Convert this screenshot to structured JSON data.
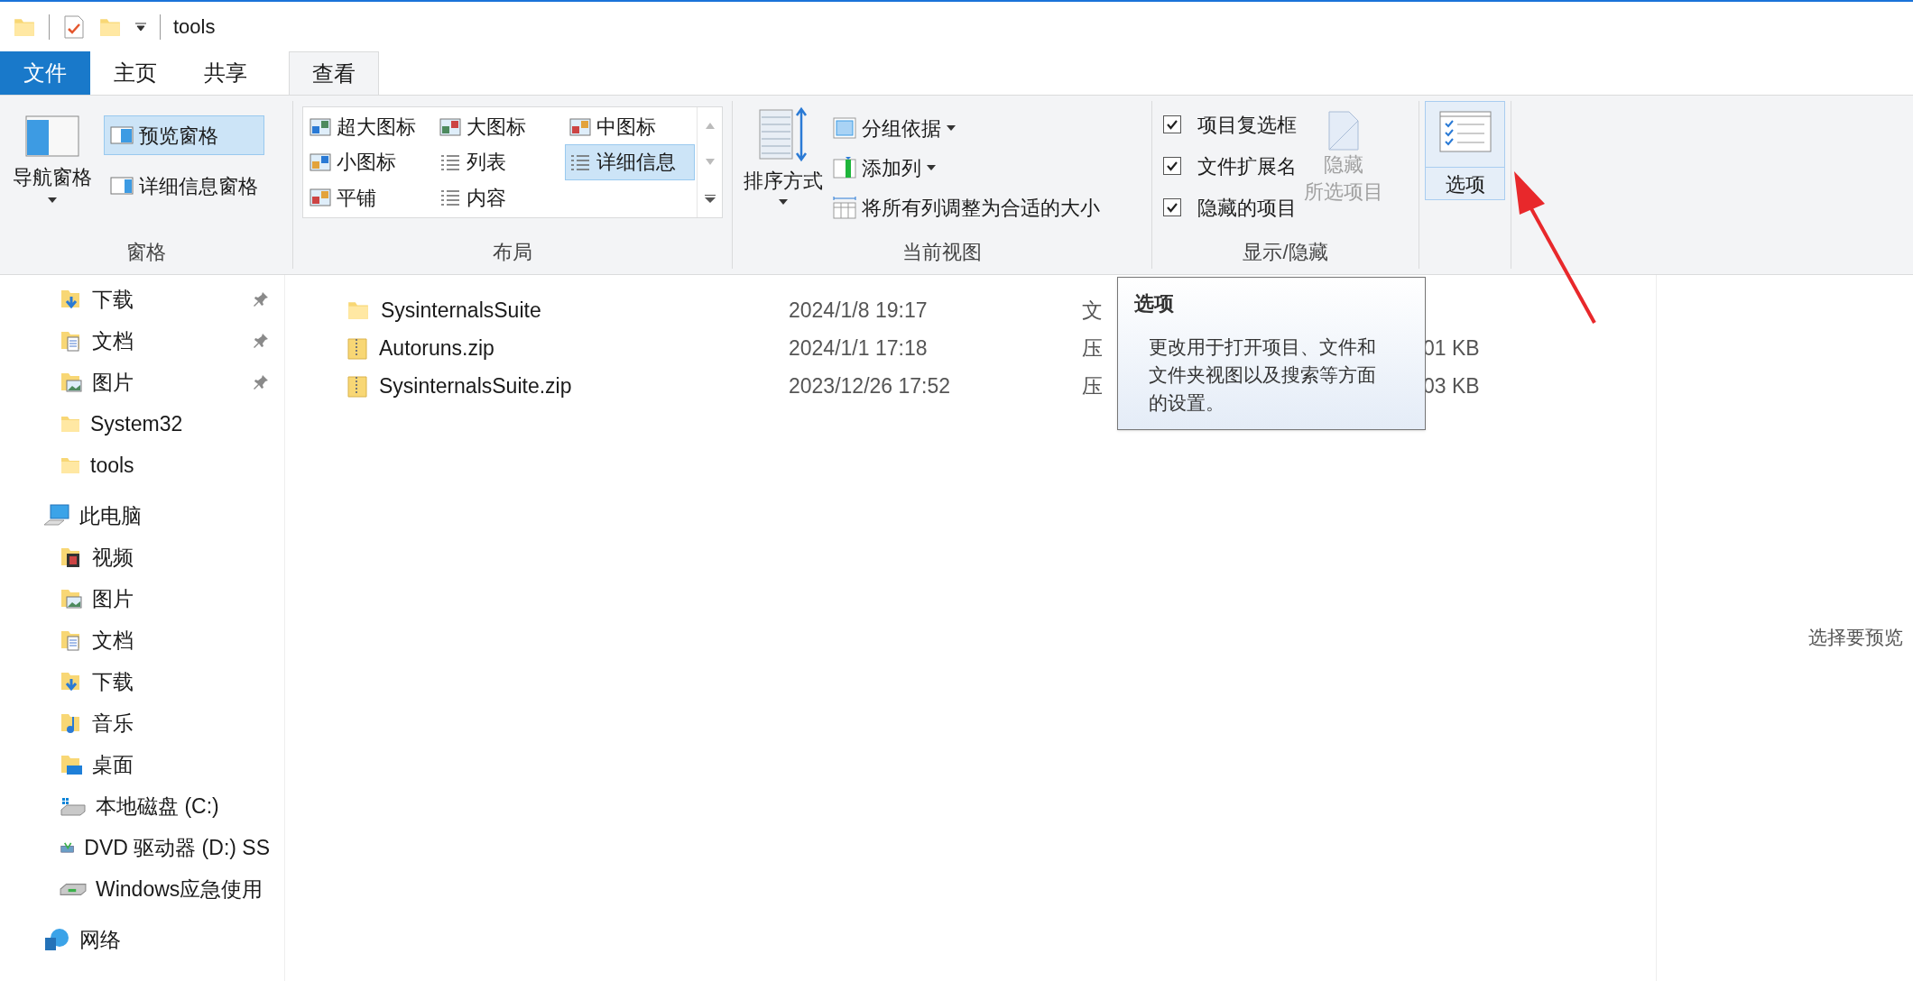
{
  "window": {
    "title": "tools"
  },
  "tabs": [
    {
      "label": "文件",
      "kind": "file",
      "selected": false
    },
    {
      "label": "主页",
      "kind": "normal",
      "selected": false
    },
    {
      "label": "共享",
      "kind": "normal",
      "selected": false
    },
    {
      "label": "查看",
      "kind": "normal",
      "selected": true
    }
  ],
  "ribbon": {
    "panes": {
      "label": "窗格",
      "nav_pane": "导航窗格",
      "preview_pane": {
        "label": "预览窗格",
        "selected": true
      },
      "details_pane": {
        "label": "详细信息窗格",
        "selected": false
      }
    },
    "layout": {
      "label": "布局",
      "items": [
        {
          "label": "超大图标",
          "selected": false
        },
        {
          "label": "大图标",
          "selected": false
        },
        {
          "label": "中图标",
          "selected": false
        },
        {
          "label": "小图标",
          "selected": false
        },
        {
          "label": "列表",
          "selected": false
        },
        {
          "label": "详细信息",
          "selected": true
        },
        {
          "label": "平铺",
          "selected": false
        },
        {
          "label": "内容",
          "selected": false
        }
      ]
    },
    "current_view": {
      "label": "当前视图",
      "sort_by": "排序方式",
      "group_by": "分组依据",
      "add_columns": "添加列",
      "fit_columns": "将所有列调整为合适的大小"
    },
    "show_hide": {
      "label": "显示/隐藏",
      "checkboxes": [
        {
          "label": "项目复选框",
          "checked": true
        },
        {
          "label": "文件扩展名",
          "checked": true
        },
        {
          "label": "隐藏的项目",
          "checked": true
        }
      ],
      "hide_selected": {
        "lines": [
          "隐藏",
          "所选项目"
        ],
        "disabled": true
      }
    },
    "options": {
      "label": "选项",
      "highlighted": true
    }
  },
  "nav_tree": [
    {
      "children": [
        {
          "label": "下载",
          "kind": "download",
          "pinned": true
        },
        {
          "label": "文档",
          "kind": "documents",
          "pinned": true
        },
        {
          "label": "图片",
          "kind": "pictures",
          "pinned": true
        },
        {
          "label": "System32",
          "kind": "folder",
          "pinned": false
        },
        {
          "label": "tools",
          "kind": "folder",
          "pinned": false
        }
      ]
    },
    {
      "label": "此电脑",
      "kind": "pc",
      "children": [
        {
          "label": "视频",
          "kind": "video"
        },
        {
          "label": "图片",
          "kind": "pictures"
        },
        {
          "label": "文档",
          "kind": "documents"
        },
        {
          "label": "下载",
          "kind": "download"
        },
        {
          "label": "音乐",
          "kind": "music"
        },
        {
          "label": "桌面",
          "kind": "desktop"
        },
        {
          "label": "本地磁盘 (C:)",
          "kind": "drive"
        },
        {
          "label": "DVD 驱动器 (D:) SS",
          "kind": "dvd"
        },
        {
          "label": "Windows应急使用",
          "kind": "usb"
        }
      ]
    },
    {
      "label": "网络",
      "kind": "network"
    }
  ],
  "files": [
    {
      "name": "SysinternalsSuite",
      "kind": "folder",
      "date": "2024/1/8 19:17",
      "type": "文"
    },
    {
      "name": "Autoruns.zip",
      "kind": "zip",
      "date": "2024/1/1 17:18",
      "type": "压",
      "size": "01 KB"
    },
    {
      "name": "SysinternalsSuite.zip",
      "kind": "zip",
      "date": "2023/12/26 17:52",
      "type": "压",
      "size": "03 KB"
    }
  ],
  "tooltip": {
    "title": "选项",
    "text": "更改用于打开项目、文件和文件夹视图以及搜索等方面的设置。"
  },
  "preview_pane": {
    "text": "选择要预览"
  }
}
